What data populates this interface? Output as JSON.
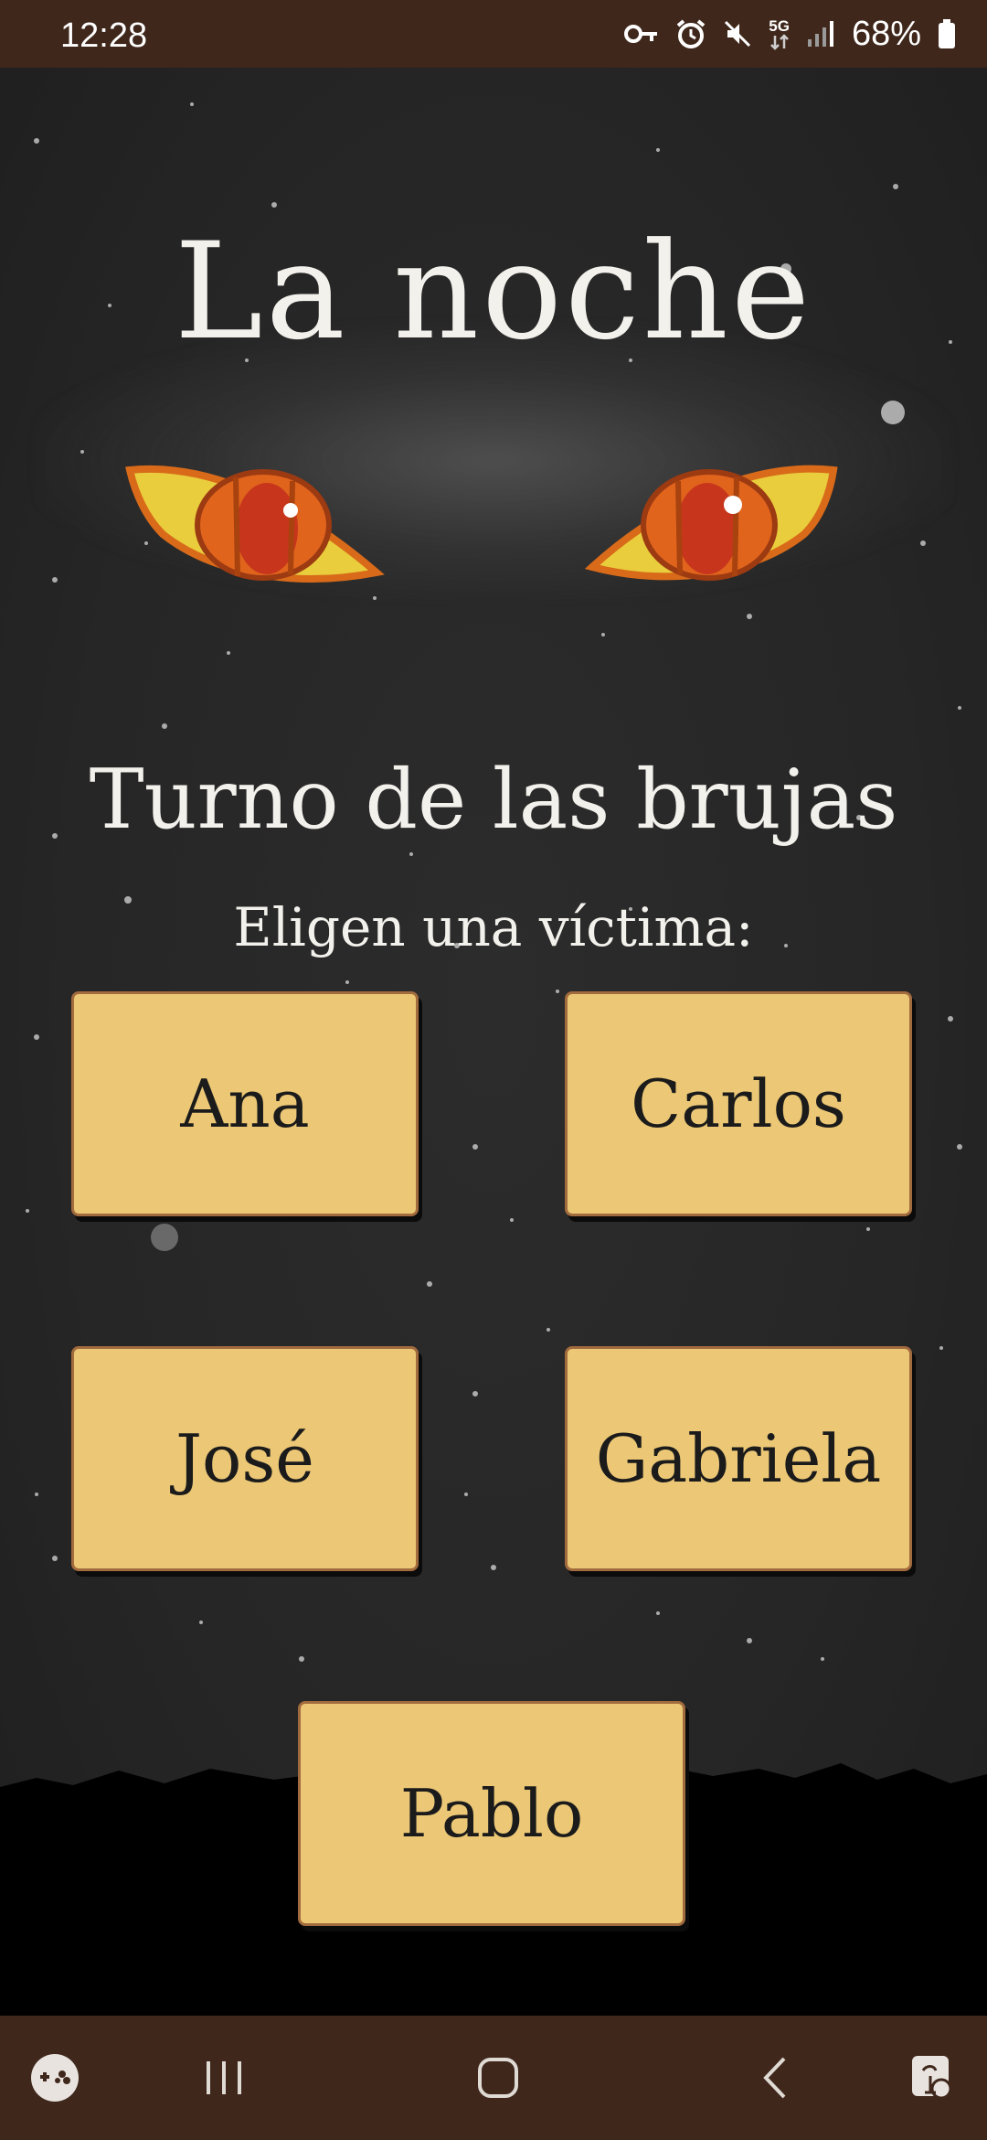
{
  "status_bar": {
    "time": "12:28",
    "network": "5G",
    "battery": "68%",
    "icons": [
      "key-icon",
      "alarm-icon",
      "mute-icon",
      "5g-icon",
      "signal-icon",
      "battery-icon"
    ]
  },
  "screen": {
    "title": "La noche",
    "turn_heading": "Turno de las brujas",
    "instruction": "Eligen una víctima:"
  },
  "players": [
    {
      "name": "Ana"
    },
    {
      "name": "Carlos"
    },
    {
      "name": "José"
    },
    {
      "name": "Gabriela"
    },
    {
      "name": "Pablo"
    }
  ],
  "nav_bar": {
    "icons": [
      "game-launcher-icon",
      "recent-apps-icon",
      "home-icon",
      "back-icon",
      "accessibility-icon"
    ]
  },
  "colors": {
    "status_bar_bg": "#3f271b",
    "button_fill": "#ecc876",
    "button_border": "#a26b3e",
    "eye_outer": "#e9cd3c",
    "eye_iris": "#e0641c"
  }
}
